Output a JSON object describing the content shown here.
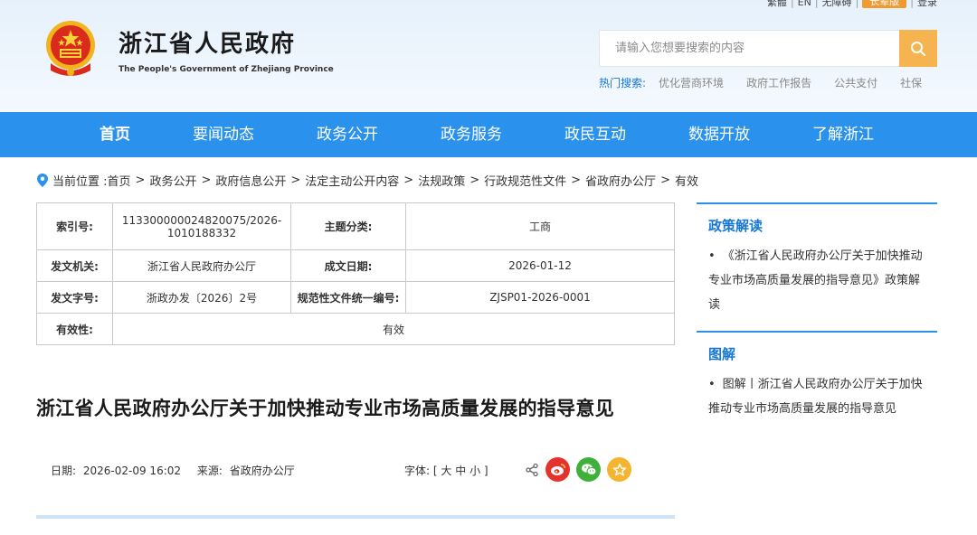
{
  "topbar": {
    "items": [
      "繁體",
      "EN",
      "无障碍"
    ],
    "old_version": "长辈版",
    "login": "登录"
  },
  "header": {
    "title": "浙江省人民政府",
    "subtitle": "The People's Government of Zhejiang Province"
  },
  "search": {
    "placeholder": "请输入您想要搜索的内容",
    "hot_label": "热门搜索:",
    "hot_items": [
      "优化营商环境",
      "政府工作报告",
      "公共支付",
      "社保"
    ]
  },
  "nav": {
    "items": [
      "首页",
      "要闻动态",
      "政务公开",
      "政务服务",
      "政民互动",
      "数据开放",
      "了解浙江"
    ]
  },
  "breadcrumb": {
    "prefix": "当前位置 :",
    "items": [
      "首页",
      "政务公开",
      "政府信息公开",
      "法定主动公开内容",
      "法规政策",
      "行政规范性文件",
      "省政府办公厅",
      "有效"
    ]
  },
  "info": {
    "index_label": "索引号:",
    "index_value": "113300000024820075/2026-1010188332",
    "topic_label": "主题分类:",
    "topic_value": "工商",
    "issuer_label": "发文机关:",
    "issuer_value": "浙江省人民政府办公厅",
    "date_label": "成文日期:",
    "date_value": "2026-01-12",
    "docno_label": "发文字号:",
    "docno_value": "浙政办发〔2026〕2号",
    "code_label": "规范性文件统一编号:",
    "code_value": "ZJSP01-2026-0001",
    "validity_label": "有效性:",
    "validity_value": "有效"
  },
  "article": {
    "title": "浙江省人民政府办公厅关于加快推动专业市场高质量发展的指导意见",
    "date_label": "日期:",
    "date_value": "2026-02-09 16:02",
    "source_label": "来源:",
    "source_value": "省政府办公厅",
    "font_label": "字体:",
    "font_open": "[",
    "font_large": "大",
    "font_medium": "中",
    "font_small": "小",
    "font_close": "]"
  },
  "sidebar": {
    "policy_head": "政策解读",
    "policy_item": "《浙江省人民政府办公厅关于加快推动专业市场高质量发展的指导意见》政策解读",
    "graphic_head": "图解",
    "graphic_item": "图解丨浙江省人民政府办公厅关于加快推动专业市场高质量发展的指导意见"
  },
  "colors": {
    "nav_bg": "#2a92ec",
    "accent_blue": "#1677d2",
    "search_btn": "#f5b450",
    "weibo": "#e6322c",
    "wechat": "#3fb13a",
    "favorite": "#f5b430"
  },
  "icons": [
    "emblem",
    "search-icon",
    "location-pin-icon",
    "share-icon",
    "weibo-icon",
    "wechat-icon",
    "star-icon"
  ]
}
